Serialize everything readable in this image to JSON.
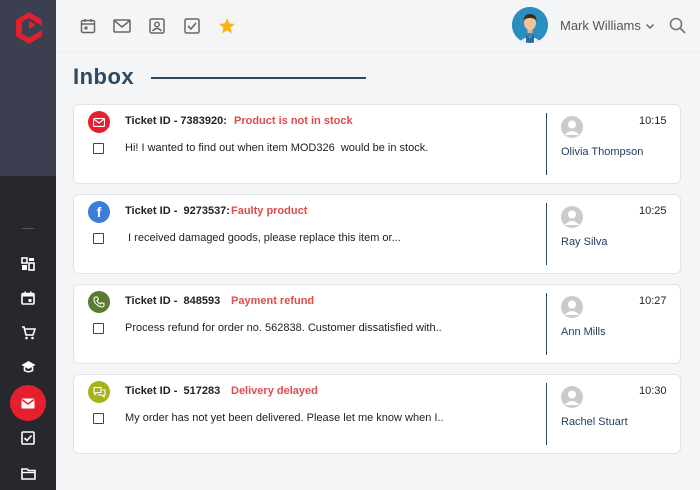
{
  "topbar": {
    "icons": [
      "calendar-icon",
      "mail-icon",
      "contact-card-icon",
      "checkbox-icon",
      "star-icon"
    ],
    "user_name": "Mark Williams"
  },
  "sidebar": {
    "icons": [
      "dashboard-icon",
      "calendar-icon",
      "cart-icon",
      "graduation-cap-icon",
      "mail-icon",
      "checkbox-icon",
      "folder-icon"
    ],
    "active": "mail-icon"
  },
  "page": {
    "title": "Inbox"
  },
  "tickets": [
    {
      "channel": "mail-icon",
      "label": "Ticket ID - 7383920:",
      "subject": "Product is not in stock",
      "preview": "Hi! I wanted to find out when item MOD326  would be in stock.",
      "agent": "Olivia Thompson",
      "time": "10:15"
    },
    {
      "channel": "facebook-icon",
      "label": "Ticket ID -  9273537:",
      "subject": "Faulty product",
      "preview": " I received damaged goods, please replace this item or...",
      "agent": "Ray Silva",
      "time": "10:25"
    },
    {
      "channel": "phone-icon",
      "label": "Ticket ID -  848593",
      "subject": "Payment refund",
      "preview": "Process refund for order no. 562838. Customer dissatisfied with..",
      "agent": "Ann Mills",
      "time": "10:27"
    },
    {
      "channel": "chat-icon",
      "label": "Ticket ID -  517283",
      "subject": "Delivery delayed",
      "preview": "My order has not yet been delivered. Please let me know when I..",
      "agent": "Rachel Stuart",
      "time": "10:30"
    }
  ],
  "colors": {
    "accent_red": "#e5202e",
    "subject_red": "#e04b4b",
    "title_navy": "#2c4a63",
    "facebook_blue": "#3b7dd8",
    "phone_green": "#5a7a2e",
    "chat_olive": "#a5b21c"
  }
}
